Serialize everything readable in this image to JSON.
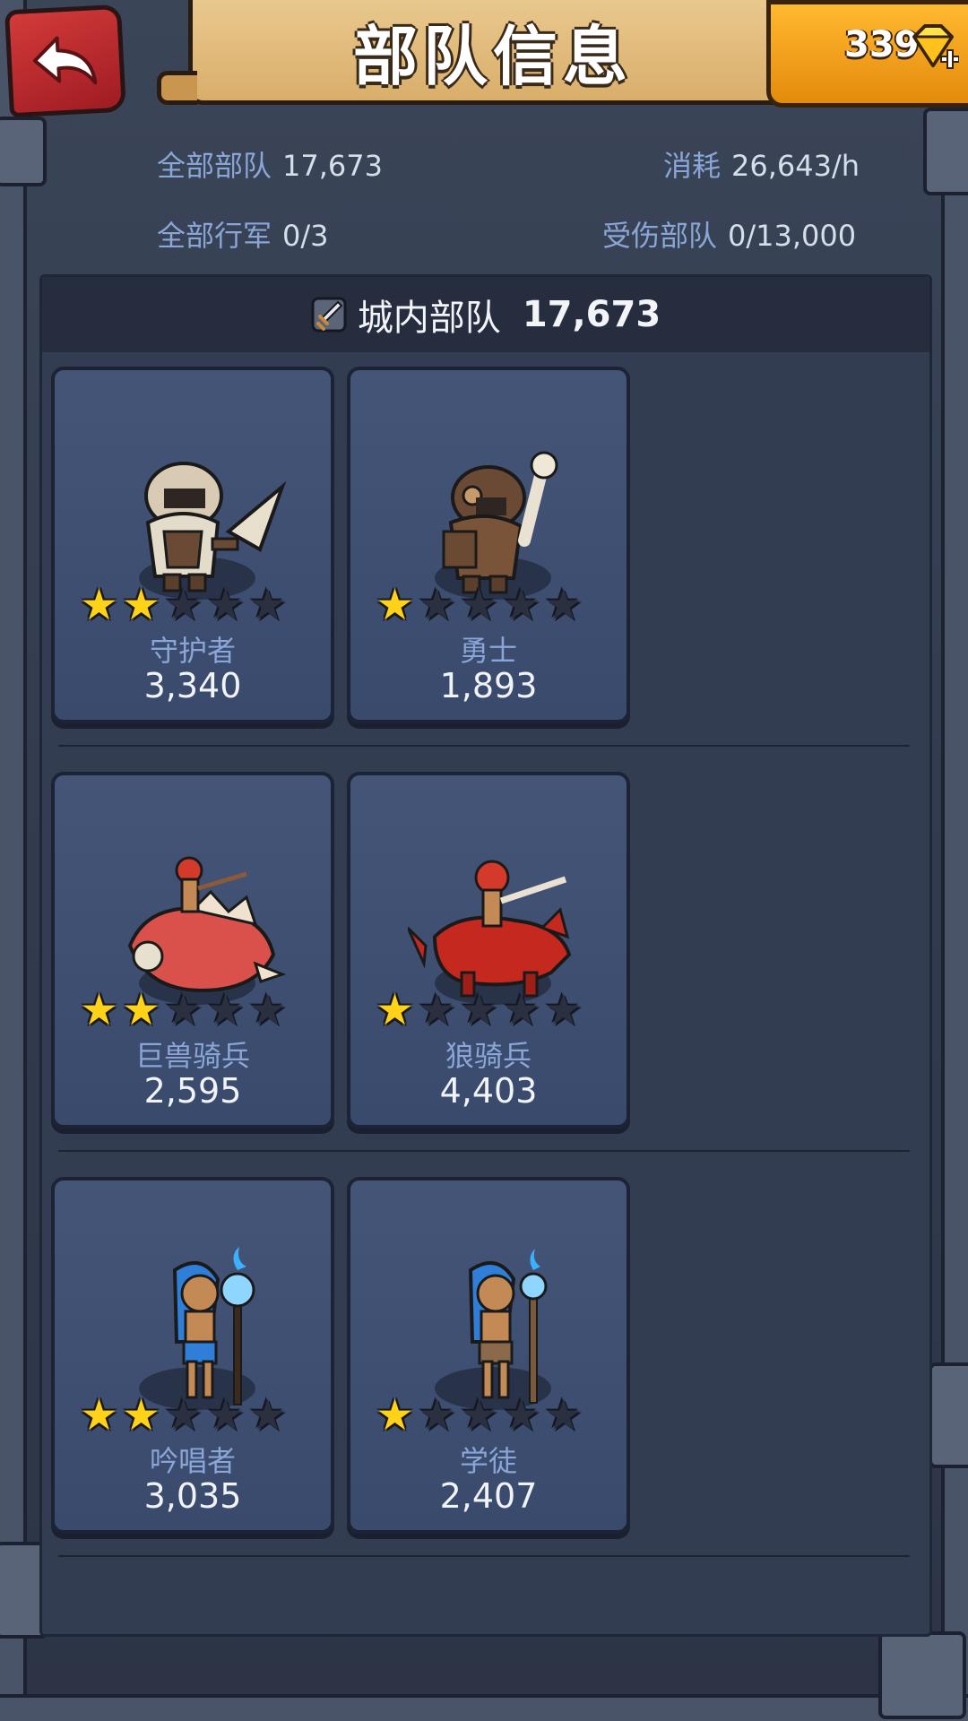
{
  "header": {
    "title": "部队信息",
    "gems": "339"
  },
  "stats": {
    "total_troops_label": "全部部队",
    "total_troops_value": "17,673",
    "upkeep_label": "消耗",
    "upkeep_value": "26,643/h",
    "marches_label": "全部行军",
    "marches_value": "0/3",
    "wounded_label": "受伤部队",
    "wounded_value": "0/13,000"
  },
  "panel": {
    "title": "城内部队",
    "count": "17,673"
  },
  "units": [
    {
      "name": "守护者",
      "count": "3,340",
      "stars": 2,
      "max_stars": 5
    },
    {
      "name": "勇士",
      "count": "1,893",
      "stars": 1,
      "max_stars": 5
    },
    {
      "name": "巨兽骑兵",
      "count": "2,595",
      "stars": 2,
      "max_stars": 5
    },
    {
      "name": "狼骑兵",
      "count": "4,403",
      "stars": 1,
      "max_stars": 5
    },
    {
      "name": "吟唱者",
      "count": "3,035",
      "stars": 2,
      "max_stars": 5
    },
    {
      "name": "学徒",
      "count": "2,407",
      "stars": 1,
      "max_stars": 5
    }
  ],
  "colors": {
    "accent_gold": "#ffd21a",
    "label_blue": "#8aa6d6",
    "back_red": "#c9302f",
    "gem_orange": "#f4a21c"
  },
  "icons": {
    "back": "back-arrow-icon",
    "gem": "diamond-plus-icon",
    "section": "sword-icon"
  }
}
